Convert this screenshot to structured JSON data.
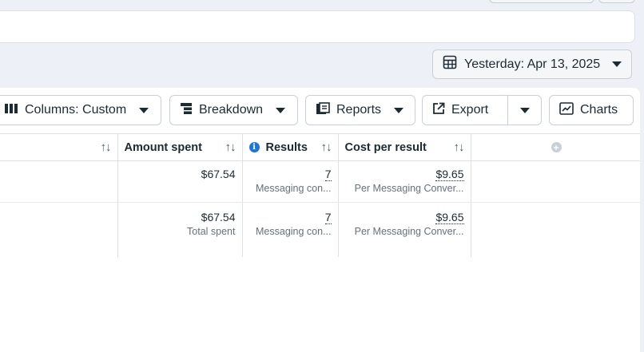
{
  "date_range": {
    "label": "Yesterday: Apr 13, 2025"
  },
  "toolbar": {
    "columns_label": "Columns: Custom",
    "breakdown_label": "Breakdown",
    "reports_label": "Reports",
    "export_label": "Export",
    "charts_label": "Charts"
  },
  "table": {
    "headers": {
      "amount_spent": "Amount spent",
      "results": "Results",
      "cost_per_result": "Cost per result"
    },
    "rows": [
      {
        "amount_spent": "$67.54",
        "amount_sub": "",
        "results": "7",
        "results_sub": "Messaging con...",
        "cost": "$9.65",
        "cost_sub": "Per Messaging Conver..."
      },
      {
        "amount_spent": "$67.54",
        "amount_sub": "Total spent",
        "results": "7",
        "results_sub": "Messaging con...",
        "cost": "$9.65",
        "cost_sub": "Per Messaging Conver..."
      }
    ]
  }
}
